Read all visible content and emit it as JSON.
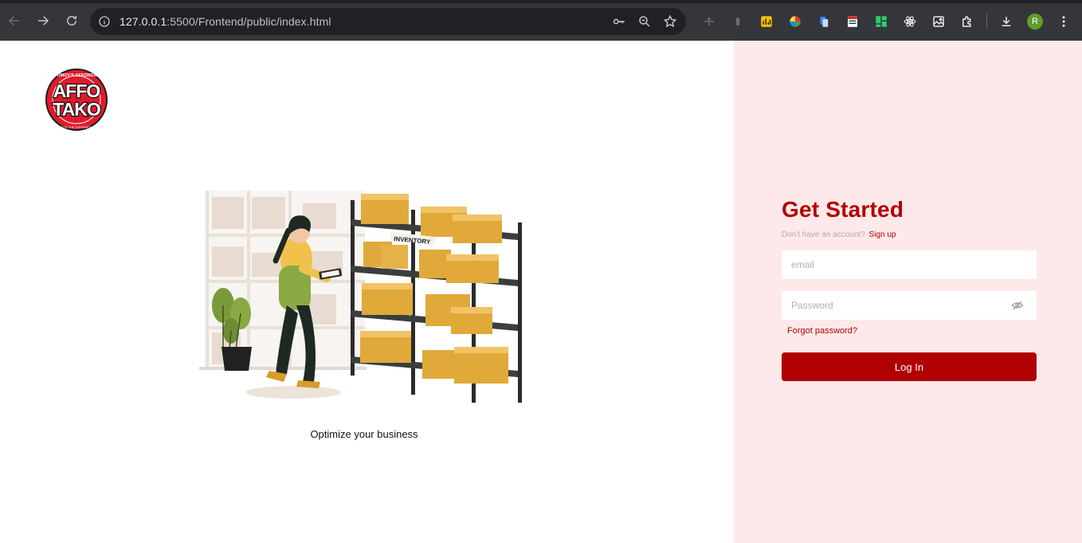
{
  "browser": {
    "url_host": "127.0.0.1",
    "url_path": ":5500/Frontend/public/index.html",
    "profile_initial": "R",
    "extensions": [
      "pen-tool-icon",
      "ink-icon",
      "chart-icon",
      "color-wheel-icon",
      "copy-icon",
      "sheet-icon",
      "grid-icon",
      "react-icon",
      "image-icon",
      "puzzle-icon"
    ]
  },
  "brand": {
    "logo_line1": "AFFO",
    "logo_line2": "TAKO",
    "logo_ring_top": "TIMOY'S AFFORDA",
    "logo_ring_bottom": "TASTE THE DIFFERENCE"
  },
  "illustration": {
    "shelf_label": "INVENTORY"
  },
  "hero": {
    "tagline": "Optimize your business"
  },
  "login": {
    "title": "Get Started",
    "no_account": "Don't have an account?",
    "signup": "Sign up",
    "email_placeholder": "email",
    "password_placeholder": "Password",
    "forgot": "Forgot password?",
    "submit": "Log In"
  },
  "colors": {
    "accent": "#b30000",
    "panel_bg": "#fde9e9",
    "chrome_bg": "#35363a"
  }
}
